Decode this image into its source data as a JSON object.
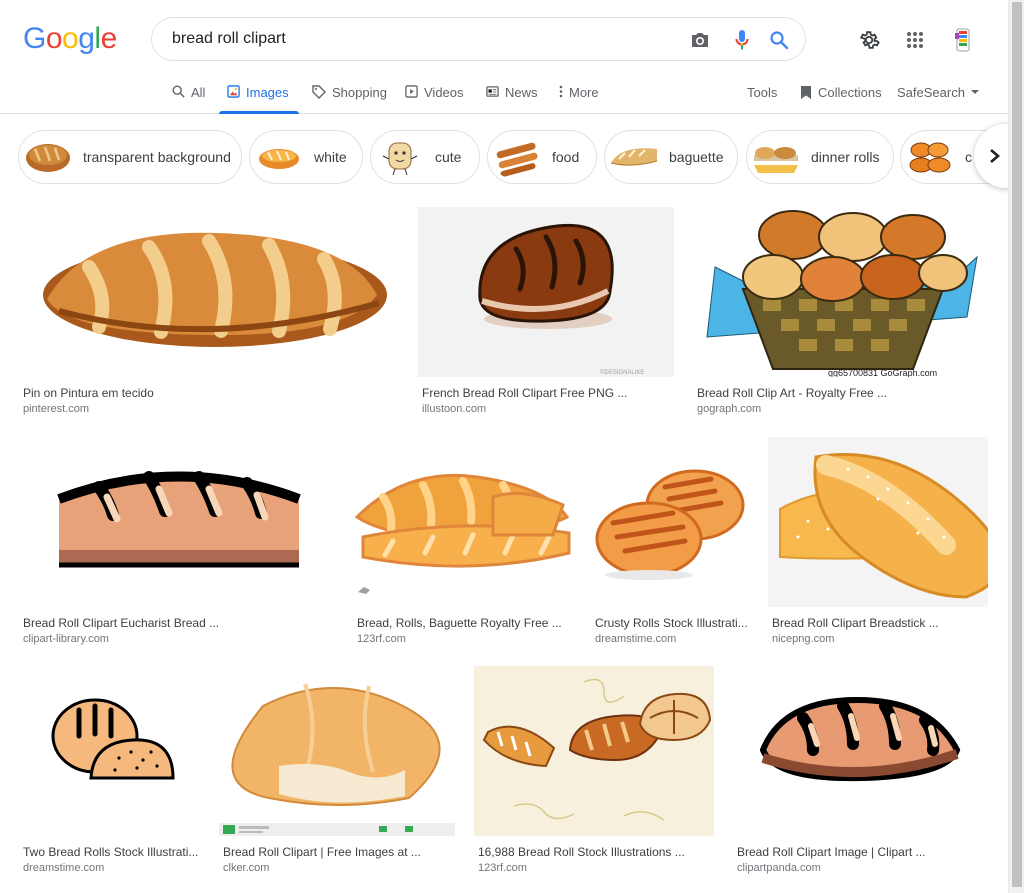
{
  "logo": {
    "letters": [
      "G",
      "o",
      "o",
      "g",
      "l",
      "e"
    ]
  },
  "search": {
    "query": "bread roll clipart"
  },
  "tabs": [
    {
      "label": "All"
    },
    {
      "label": "Images"
    },
    {
      "label": "Shopping"
    },
    {
      "label": "Videos"
    },
    {
      "label": "News"
    },
    {
      "label": "More"
    }
  ],
  "tools": {
    "tools": "Tools",
    "collections": "Collections",
    "safesearch": "SafeSearch"
  },
  "chips": [
    {
      "label": "transparent background"
    },
    {
      "label": "white"
    },
    {
      "label": "cute"
    },
    {
      "label": "food"
    },
    {
      "label": "baguette"
    },
    {
      "label": "dinner rolls"
    },
    {
      "label": "c"
    }
  ],
  "results": [
    {
      "caption": "Pin on Pintura em tecido",
      "source": "pinterest.com"
    },
    {
      "caption": "French Bread Roll Clipart Free PNG ...",
      "source": "illustoon.com",
      "watermark": "©DESIGNALIKE"
    },
    {
      "caption": "Bread Roll Clip Art - Royalty Free ...",
      "source": "gograph.com",
      "watermark": "gg65700831 GoGraph.com"
    },
    {
      "caption": "Bread Roll Clipart Eucharist Bread ...",
      "source": "clipart-library.com"
    },
    {
      "caption": "Bread, Rolls, Baguette Royalty Free ...",
      "source": "123rf.com"
    },
    {
      "caption": "Crusty Rolls Stock Illustrati...",
      "source": "dreamstime.com"
    },
    {
      "caption": "Bread Roll Clipart Breadstick ...",
      "source": "nicepng.com"
    },
    {
      "caption": "Two Bread Rolls Stock Illustrati...",
      "source": "dreamstime.com"
    },
    {
      "caption": "Bread Roll Clipart | Free Images at ...",
      "source": "clker.com"
    },
    {
      "caption": "16,988 Bread Roll Stock Illustrations ...",
      "source": "123rf.com"
    },
    {
      "caption": "Bread Roll Clipart Image | Clipart ...",
      "source": "clipartpanda.com"
    }
  ],
  "colors": {
    "accent": "#1a73e8",
    "border": "#dfe1e5",
    "muted": "#70757a"
  }
}
